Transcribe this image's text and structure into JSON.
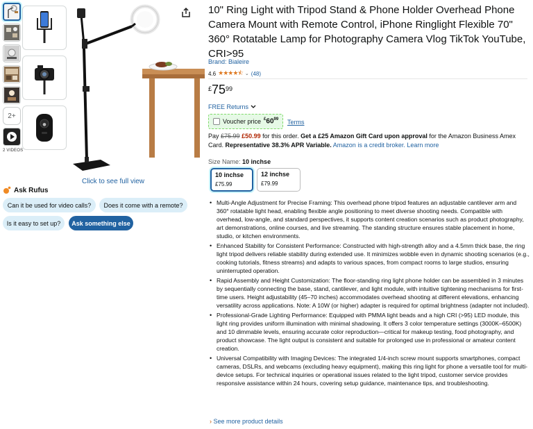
{
  "gallery": {
    "more_label": "2+",
    "videos_label": "2 VIDEOS",
    "full_view": "Click to see full view"
  },
  "rufus": {
    "title": "Ask Rufus",
    "chips": [
      "Can it be used for video calls?",
      "Does it come with a remote?",
      "Is it easy to set up?",
      "Ask something else"
    ]
  },
  "product": {
    "title": "10\" Ring Light with Tripod Stand & Phone Holder Overhead Phone Camera Mount with Remote Control, iPhone Ringlight Flexible 70\" 360° Rotatable Lamp for Photography Camera Vlog TikTok YouTube, CRI>95",
    "brand": "Brand: Bialeire",
    "rating": "4.6",
    "rating_value": 4.6,
    "rating_count": "(48)",
    "price_symbol": "£",
    "price_whole": "75",
    "price_fraction": "99",
    "returns": "FREE Returns",
    "voucher_label": "Voucher price",
    "voucher_symbol": "£",
    "voucher_whole": "60",
    "voucher_fraction": "99",
    "terms": "Terms"
  },
  "promo": {
    "pay": "Pay",
    "old_price": "£75.99",
    "new_price": "£50.99",
    "for_order": "for this order.",
    "bold1": "Get a £25 Amazon Gift Card upon approval",
    "mid": "for the Amazon Business Amex Card.",
    "bold2": "Representative 38.3% APR Variable.",
    "link": "Amazon is a credit broker. Learn more"
  },
  "size": {
    "label": "Size Name:",
    "value": "10 inchse",
    "options": [
      {
        "label": "10 inchse",
        "price": "£75.99"
      },
      {
        "label": "12 inchse",
        "price": "£79.99"
      }
    ]
  },
  "bullets": [
    "Multi-Angle Adjustment for Precise Framing: This overhead phone tripod features an adjustable cantilever arm and 360° rotatable light head, enabling flexible angle positioning to meet diverse shooting needs. Compatible with overhead, low-angle, and standard perspectives, it supports content creation scenarios such as product photography, art demonstrations, online courses, and live streaming. The standing structure ensures stable placement in home, studio, or kitchen environments.",
    "Enhanced Stability for Consistent Performance: Constructed with high-strength alloy and a 4.5mm thick base, the ring light tripod delivers reliable stability during extended use. It minimizes wobble even in dynamic shooting scenarios (e.g., cooking tutorials, fitness streams) and adapts to various spaces, from compact rooms to large studios, ensuring uninterrupted operation.",
    "Rapid Assembly and Height Customization: The floor-standing ring light phone holder can be assembled in 3 minutes by sequentially connecting the base, stand, cantilever, and light module, with intuitive tightening mechanisms for first-time users. Height adjustability (45–70 inches) accommodates overhead shooting at different elevations, enhancing versatility across applications. Note: A 10W (or higher) adapter is required for optimal brightness (adapter not included).",
    "Professional-Grade Lighting Performance: Equipped with PMMA light beads and a high CRI (>95) LED module, this light ring provides uniform illumination with minimal shadowing. It offers 3 color temperature settings (3000K–6500K) and 10 dimmable levels, ensuring accurate color reproduction—critical for makeup testing, food photography, and product showcase. The light output is consistent and suitable for prolonged use in professional or amateur content creation.",
    "Universal Compatibility with Imaging Devices: The integrated 1/4-inch screw mount supports smartphones, compact cameras, DSLRs, and webcams (excluding heavy equipment), making this ring light for phone a versatile tool for multi-device setups. For technical inquiries or operational issues related to the light tripod, customer service provides responsive assistance within 24 hours, covering setup guidance, maintenance tips, and troubleshooting."
  ],
  "see_more": "See more product details",
  "colors": {
    "link": "#2162a1",
    "star": "#de7921",
    "deal_red": "#b12704",
    "chip_bg": "#dbeef8"
  }
}
